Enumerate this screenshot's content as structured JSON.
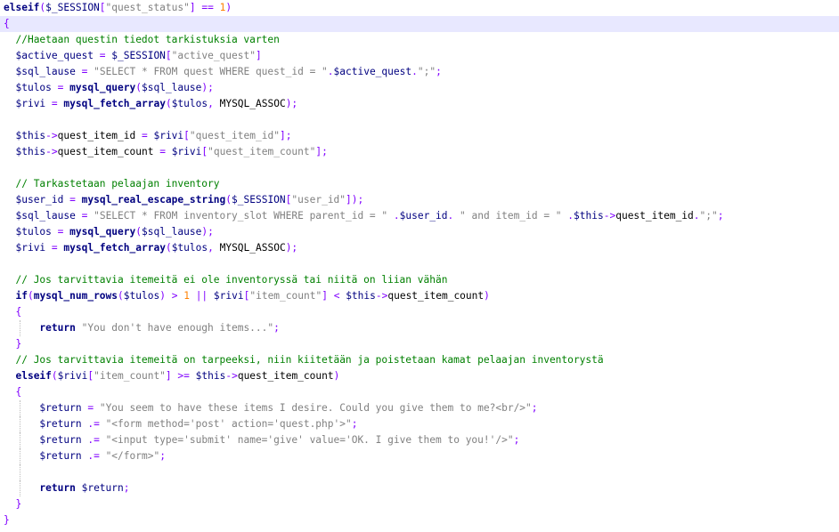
{
  "editor": {
    "language": "php",
    "colors": {
      "background": "#ffffff",
      "current_line": "#e8e8ff",
      "keyword": "#000080",
      "string": "#808080",
      "number": "#ff8000",
      "comment": "#008000",
      "operator": "#8000ff",
      "indent_guide": "#bdbdbd"
    },
    "lines": [
      {
        "tokens": [
          [
            "kw",
            "elseif"
          ],
          [
            "op",
            "("
          ],
          [
            "var",
            "$_SESSION"
          ],
          [
            "op",
            "["
          ],
          [
            "str",
            "\"quest_status\""
          ],
          [
            "op",
            "]"
          ],
          [
            "plain",
            " "
          ],
          [
            "op",
            "=="
          ],
          [
            "plain",
            " "
          ],
          [
            "num",
            "1"
          ],
          [
            "op",
            ")"
          ]
        ]
      },
      {
        "highlighted": true,
        "tokens": [
          [
            "op",
            "{"
          ]
        ]
      },
      {
        "tokens": [
          [
            "plain",
            "  "
          ],
          [
            "cmt",
            "//Haetaan questin tiedot tarkistuksia varten"
          ]
        ]
      },
      {
        "tokens": [
          [
            "plain",
            "  "
          ],
          [
            "var",
            "$active_quest"
          ],
          [
            "plain",
            " "
          ],
          [
            "op",
            "="
          ],
          [
            "plain",
            " "
          ],
          [
            "var",
            "$_SESSION"
          ],
          [
            "op",
            "["
          ],
          [
            "str",
            "\"active_quest\""
          ],
          [
            "op",
            "]"
          ]
        ]
      },
      {
        "tokens": [
          [
            "plain",
            "  "
          ],
          [
            "var",
            "$sql_lause"
          ],
          [
            "plain",
            " "
          ],
          [
            "op",
            "="
          ],
          [
            "plain",
            " "
          ],
          [
            "str",
            "\"SELECT * FROM quest WHERE quest_id = \""
          ],
          [
            "op",
            "."
          ],
          [
            "var",
            "$active_quest"
          ],
          [
            "op",
            "."
          ],
          [
            "str",
            "\";\""
          ],
          [
            "op",
            ";"
          ]
        ]
      },
      {
        "tokens": [
          [
            "plain",
            "  "
          ],
          [
            "var",
            "$tulos"
          ],
          [
            "plain",
            " "
          ],
          [
            "op",
            "="
          ],
          [
            "plain",
            " "
          ],
          [
            "fn",
            "mysql_query"
          ],
          [
            "op",
            "("
          ],
          [
            "var",
            "$sql_lause"
          ],
          [
            "op",
            ");"
          ]
        ]
      },
      {
        "tokens": [
          [
            "plain",
            "  "
          ],
          [
            "var",
            "$rivi"
          ],
          [
            "plain",
            " "
          ],
          [
            "op",
            "="
          ],
          [
            "plain",
            " "
          ],
          [
            "fn",
            "mysql_fetch_array"
          ],
          [
            "op",
            "("
          ],
          [
            "var",
            "$tulos"
          ],
          [
            "op",
            ","
          ],
          [
            "plain",
            " MYSQL_ASSOC"
          ],
          [
            "op",
            ");"
          ]
        ]
      },
      {
        "tokens": []
      },
      {
        "tokens": [
          [
            "plain",
            "  "
          ],
          [
            "var",
            "$this"
          ],
          [
            "op",
            "->"
          ],
          [
            "plain",
            "quest_item_id"
          ],
          [
            "plain",
            " "
          ],
          [
            "op",
            "="
          ],
          [
            "plain",
            " "
          ],
          [
            "var",
            "$rivi"
          ],
          [
            "op",
            "["
          ],
          [
            "str",
            "\"quest_item_id\""
          ],
          [
            "op",
            "];"
          ]
        ]
      },
      {
        "tokens": [
          [
            "plain",
            "  "
          ],
          [
            "var",
            "$this"
          ],
          [
            "op",
            "->"
          ],
          [
            "plain",
            "quest_item_count"
          ],
          [
            "plain",
            " "
          ],
          [
            "op",
            "="
          ],
          [
            "plain",
            " "
          ],
          [
            "var",
            "$rivi"
          ],
          [
            "op",
            "["
          ],
          [
            "str",
            "\"quest_item_count\""
          ],
          [
            "op",
            "];"
          ]
        ]
      },
      {
        "tokens": []
      },
      {
        "tokens": [
          [
            "plain",
            "  "
          ],
          [
            "cmt",
            "// Tarkastetaan pelaajan inventory"
          ]
        ]
      },
      {
        "tokens": [
          [
            "plain",
            "  "
          ],
          [
            "var",
            "$user_id"
          ],
          [
            "plain",
            " "
          ],
          [
            "op",
            "="
          ],
          [
            "plain",
            " "
          ],
          [
            "fn",
            "mysql_real_escape_string"
          ],
          [
            "op",
            "("
          ],
          [
            "var",
            "$_SESSION"
          ],
          [
            "op",
            "["
          ],
          [
            "str",
            "\"user_id\""
          ],
          [
            "op",
            "]);"
          ]
        ]
      },
      {
        "tokens": [
          [
            "plain",
            "  "
          ],
          [
            "var",
            "$sql_lause"
          ],
          [
            "plain",
            " "
          ],
          [
            "op",
            "="
          ],
          [
            "plain",
            " "
          ],
          [
            "str",
            "\"SELECT * FROM inventory_slot WHERE parent_id = \""
          ],
          [
            "plain",
            " "
          ],
          [
            "op",
            "."
          ],
          [
            "var",
            "$user_id"
          ],
          [
            "op",
            "."
          ],
          [
            "plain",
            " "
          ],
          [
            "str",
            "\" and item_id = \""
          ],
          [
            "plain",
            " "
          ],
          [
            "op",
            "."
          ],
          [
            "var",
            "$this"
          ],
          [
            "op",
            "->"
          ],
          [
            "plain",
            "quest_item_id"
          ],
          [
            "op",
            "."
          ],
          [
            "str",
            "\";\""
          ],
          [
            "op",
            ";"
          ]
        ]
      },
      {
        "tokens": [
          [
            "plain",
            "  "
          ],
          [
            "var",
            "$tulos"
          ],
          [
            "plain",
            " "
          ],
          [
            "op",
            "="
          ],
          [
            "plain",
            " "
          ],
          [
            "fn",
            "mysql_query"
          ],
          [
            "op",
            "("
          ],
          [
            "var",
            "$sql_lause"
          ],
          [
            "op",
            ");"
          ]
        ]
      },
      {
        "tokens": [
          [
            "plain",
            "  "
          ],
          [
            "var",
            "$rivi"
          ],
          [
            "plain",
            " "
          ],
          [
            "op",
            "="
          ],
          [
            "plain",
            " "
          ],
          [
            "fn",
            "mysql_fetch_array"
          ],
          [
            "op",
            "("
          ],
          [
            "var",
            "$tulos"
          ],
          [
            "op",
            ","
          ],
          [
            "plain",
            " MYSQL_ASSOC"
          ],
          [
            "op",
            ");"
          ]
        ]
      },
      {
        "tokens": []
      },
      {
        "tokens": [
          [
            "plain",
            "  "
          ],
          [
            "cmt",
            "// Jos tarvittavia itemeitä ei ole inventoryssä tai niitä on liian vähän"
          ]
        ]
      },
      {
        "tokens": [
          [
            "plain",
            "  "
          ],
          [
            "kw",
            "if"
          ],
          [
            "op",
            "("
          ],
          [
            "fn",
            "mysql_num_rows"
          ],
          [
            "op",
            "("
          ],
          [
            "var",
            "$tulos"
          ],
          [
            "op",
            ")"
          ],
          [
            "plain",
            " "
          ],
          [
            "op",
            ">"
          ],
          [
            "plain",
            " "
          ],
          [
            "num",
            "1"
          ],
          [
            "plain",
            " "
          ],
          [
            "op",
            "||"
          ],
          [
            "plain",
            " "
          ],
          [
            "var",
            "$rivi"
          ],
          [
            "op",
            "["
          ],
          [
            "str",
            "\"item_count\""
          ],
          [
            "op",
            "]"
          ],
          [
            "plain",
            " "
          ],
          [
            "op",
            "<"
          ],
          [
            "plain",
            " "
          ],
          [
            "var",
            "$this"
          ],
          [
            "op",
            "->"
          ],
          [
            "plain",
            "quest_item_count"
          ],
          [
            "op",
            ")"
          ]
        ]
      },
      {
        "tokens": [
          [
            "plain",
            "  "
          ],
          [
            "op",
            "{"
          ]
        ]
      },
      {
        "guides": [
          1
        ],
        "tokens": [
          [
            "plain",
            "      "
          ],
          [
            "kw",
            "return"
          ],
          [
            "plain",
            " "
          ],
          [
            "str",
            "\"You don't have enough items...\""
          ],
          [
            "op",
            ";"
          ]
        ]
      },
      {
        "tokens": [
          [
            "plain",
            "  "
          ],
          [
            "op",
            "}"
          ]
        ]
      },
      {
        "tokens": [
          [
            "plain",
            "  "
          ],
          [
            "cmt",
            "// Jos tarvittavia itemeitä on tarpeeksi, niin kiitetään ja poistetaan kamat pelaajan inventorystä"
          ]
        ]
      },
      {
        "tokens": [
          [
            "plain",
            "  "
          ],
          [
            "kw",
            "elseif"
          ],
          [
            "op",
            "("
          ],
          [
            "var",
            "$rivi"
          ],
          [
            "op",
            "["
          ],
          [
            "str",
            "\"item_count\""
          ],
          [
            "op",
            "]"
          ],
          [
            "plain",
            " "
          ],
          [
            "op",
            ">="
          ],
          [
            "plain",
            " "
          ],
          [
            "var",
            "$this"
          ],
          [
            "op",
            "->"
          ],
          [
            "plain",
            "quest_item_count"
          ],
          [
            "op",
            ")"
          ]
        ]
      },
      {
        "tokens": [
          [
            "plain",
            "  "
          ],
          [
            "op",
            "{"
          ]
        ]
      },
      {
        "guides": [
          1
        ],
        "tokens": [
          [
            "plain",
            "      "
          ],
          [
            "var",
            "$return"
          ],
          [
            "plain",
            " "
          ],
          [
            "op",
            "="
          ],
          [
            "plain",
            " "
          ],
          [
            "str",
            "\"You seem to have these items I desire. Could you give them to me?<br/>\""
          ],
          [
            "op",
            ";"
          ]
        ]
      },
      {
        "guides": [
          1
        ],
        "tokens": [
          [
            "plain",
            "      "
          ],
          [
            "var",
            "$return"
          ],
          [
            "plain",
            " "
          ],
          [
            "op",
            ".="
          ],
          [
            "plain",
            " "
          ],
          [
            "str",
            "\"<form method='post' action='quest.php'>\""
          ],
          [
            "op",
            ";"
          ]
        ]
      },
      {
        "guides": [
          1
        ],
        "tokens": [
          [
            "plain",
            "      "
          ],
          [
            "var",
            "$return"
          ],
          [
            "plain",
            " "
          ],
          [
            "op",
            ".="
          ],
          [
            "plain",
            " "
          ],
          [
            "str",
            "\"<input type='submit' name='give' value='OK. I give them to you!'/>\""
          ],
          [
            "op",
            ";"
          ]
        ]
      },
      {
        "guides": [
          1
        ],
        "tokens": [
          [
            "plain",
            "      "
          ],
          [
            "var",
            "$return"
          ],
          [
            "plain",
            " "
          ],
          [
            "op",
            ".="
          ],
          [
            "plain",
            " "
          ],
          [
            "str",
            "\"</form>\""
          ],
          [
            "op",
            ";"
          ]
        ]
      },
      {
        "guides": [
          1
        ],
        "tokens": []
      },
      {
        "guides": [
          1
        ],
        "tokens": [
          [
            "plain",
            "      "
          ],
          [
            "kw",
            "return"
          ],
          [
            "plain",
            " "
          ],
          [
            "var",
            "$return"
          ],
          [
            "op",
            ";"
          ]
        ]
      },
      {
        "tokens": [
          [
            "plain",
            "  "
          ],
          [
            "op",
            "}"
          ]
        ]
      },
      {
        "tokens": [
          [
            "op",
            "}"
          ]
        ]
      }
    ]
  }
}
